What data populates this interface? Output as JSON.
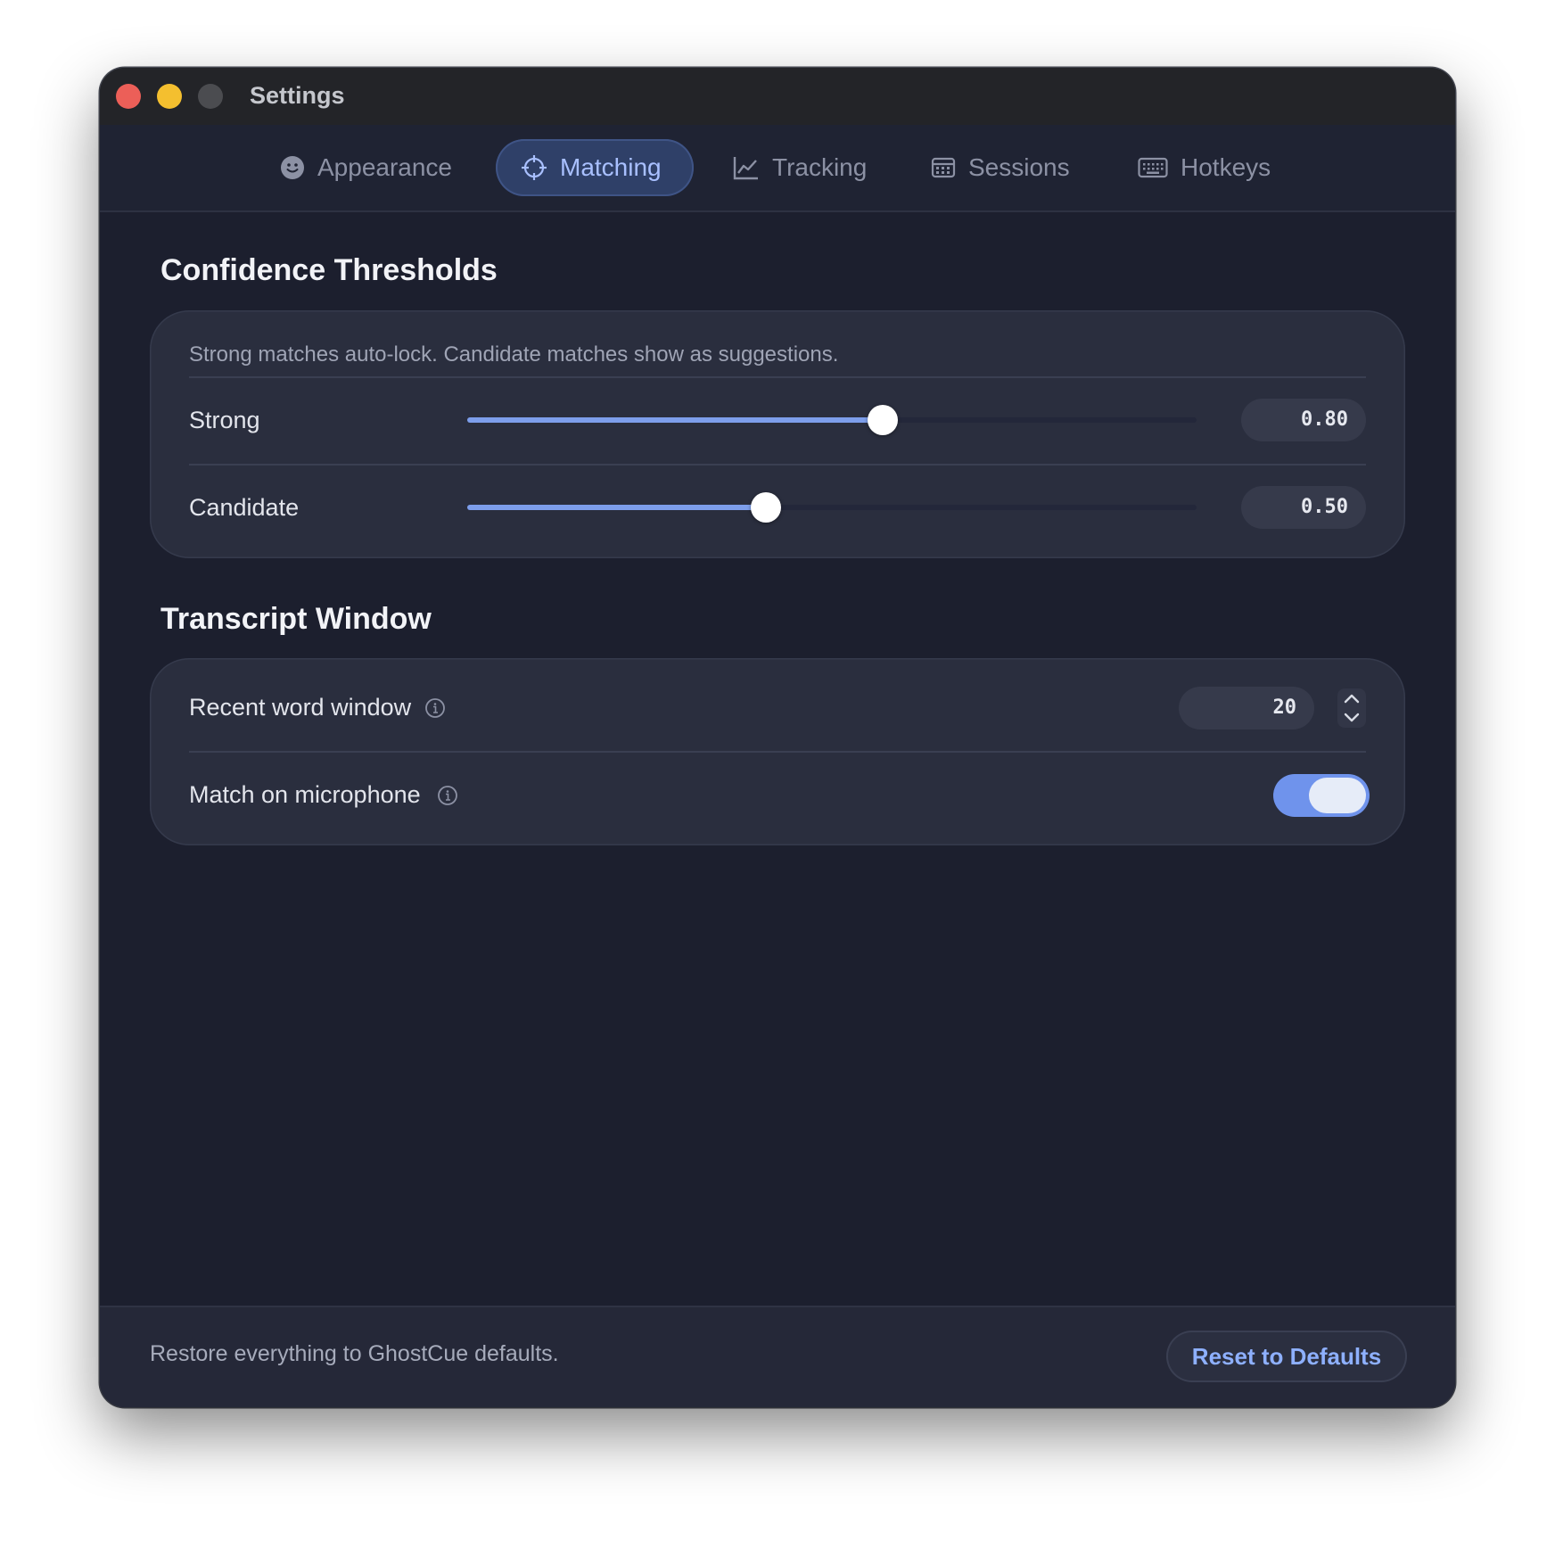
{
  "window": {
    "title": "Settings"
  },
  "tabs": [
    {
      "label": "Appearance",
      "icon": "smiley-icon",
      "active": false
    },
    {
      "label": "Matching",
      "icon": "crosshair-icon",
      "active": true
    },
    {
      "label": "Tracking",
      "icon": "chart-line-icon",
      "active": false
    },
    {
      "label": "Sessions",
      "icon": "calendar-icon",
      "active": false
    },
    {
      "label": "Hotkeys",
      "icon": "keyboard-icon",
      "active": false
    }
  ],
  "confidence": {
    "title": "Confidence Thresholds",
    "description": "Strong matches auto-lock. Candidate matches show as suggestions.",
    "strong": {
      "label": "Strong",
      "value": 0.8,
      "display": "0.80",
      "fill_fraction": 0.57
    },
    "candidate": {
      "label": "Candidate",
      "value": 0.5,
      "display": "0.50",
      "fill_fraction": 0.41
    }
  },
  "transcript": {
    "title": "Transcript Window",
    "recent_word_window": {
      "label": "Recent word window",
      "value": "20"
    },
    "match_on_microphone": {
      "label": "Match on microphone",
      "enabled": true
    }
  },
  "footer": {
    "text": "Restore everything to GhostCue defaults.",
    "reset_label": "Reset to Defaults"
  },
  "colors": {
    "accent": "#7d9eeb",
    "active_tab_bg": "#2f4068",
    "active_tab_text": "#a9c0ff",
    "toggle_on": "#6f93ec",
    "close": "#ec5f58",
    "minimize": "#f4bf2f"
  }
}
